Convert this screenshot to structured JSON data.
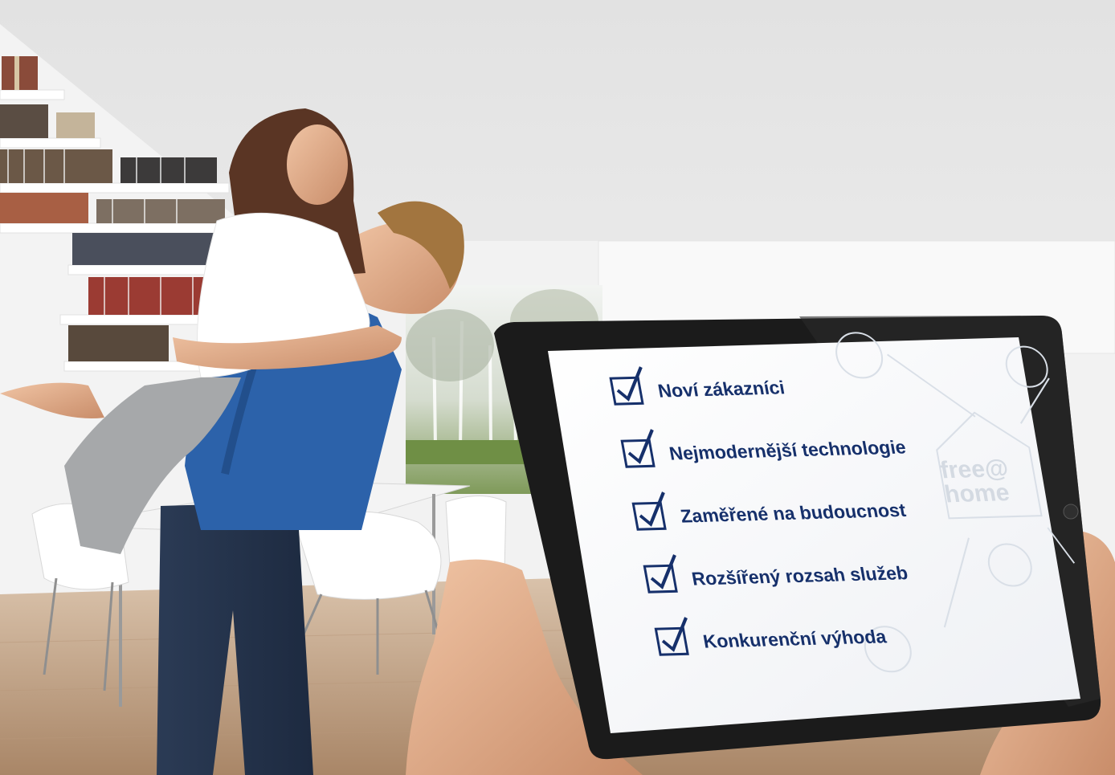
{
  "photo": {
    "subject": "couple-embracing-in-bright-living-room",
    "palette": {
      "ceiling": "#eeeeee",
      "floor": "#c7a88b",
      "wall": "#f4f4f4",
      "brand_navy": "#16306b",
      "tablet_bezel": "#1b1b1b"
    }
  },
  "tablet": {
    "checklist": [
      {
        "label": "Noví zákazníci",
        "checked": true
      },
      {
        "label": "Nejmodernější technologie",
        "checked": true
      },
      {
        "label": "Zaměřené na budoucnost",
        "checked": true
      },
      {
        "label": "Rozšířený rozsah služeb",
        "checked": true
      },
      {
        "label": "Konkurenční výhoda",
        "checked": true
      }
    ],
    "watermark": {
      "line1": "free@",
      "line2": "home"
    },
    "watermark_icons": [
      "door-icon",
      "window-icon",
      "heating-icon",
      "fan-icon"
    ]
  }
}
